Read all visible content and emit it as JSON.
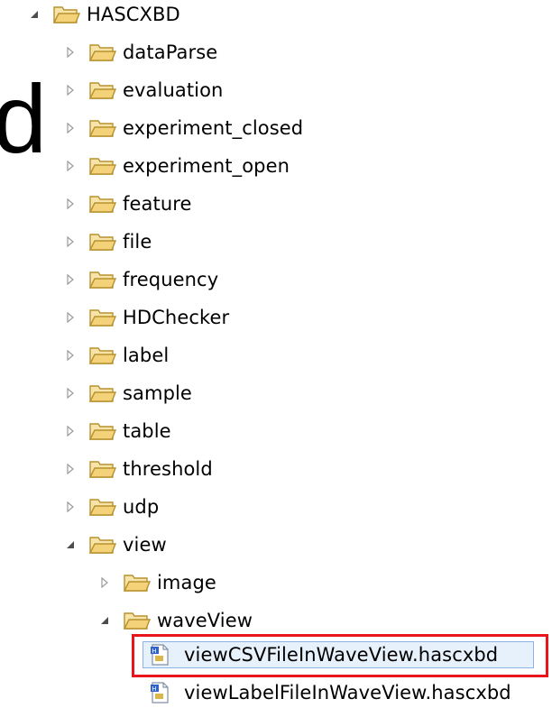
{
  "background_text": "d",
  "tree": {
    "root": {
      "label": "HASCXBD",
      "expanded": true
    },
    "folders": [
      {
        "label": "dataParse",
        "expanded": false
      },
      {
        "label": "evaluation",
        "expanded": false
      },
      {
        "label": "experiment_closed",
        "expanded": false
      },
      {
        "label": "experiment_open",
        "expanded": false
      },
      {
        "label": "feature",
        "expanded": false
      },
      {
        "label": "file",
        "expanded": false
      },
      {
        "label": "frequency",
        "expanded": false
      },
      {
        "label": "HDChecker",
        "expanded": false
      },
      {
        "label": "label",
        "expanded": false
      },
      {
        "label": "sample",
        "expanded": false
      },
      {
        "label": "table",
        "expanded": false
      },
      {
        "label": "threshold",
        "expanded": false
      },
      {
        "label": "udp",
        "expanded": false
      },
      {
        "label": "view",
        "expanded": true
      }
    ],
    "view_children": [
      {
        "label": "image",
        "expanded": false
      },
      {
        "label": "waveView",
        "expanded": true
      }
    ],
    "files": [
      {
        "label": "viewCSVFileInWaveView.hascxbd",
        "selected": true
      },
      {
        "label": "viewLabelFileInWaveView.hascxbd",
        "selected": false
      }
    ]
  },
  "colors": {
    "highlight_border": "#e8161c",
    "selection_bg": "#e7f1fb",
    "folder_fill": "#f3d27a"
  }
}
